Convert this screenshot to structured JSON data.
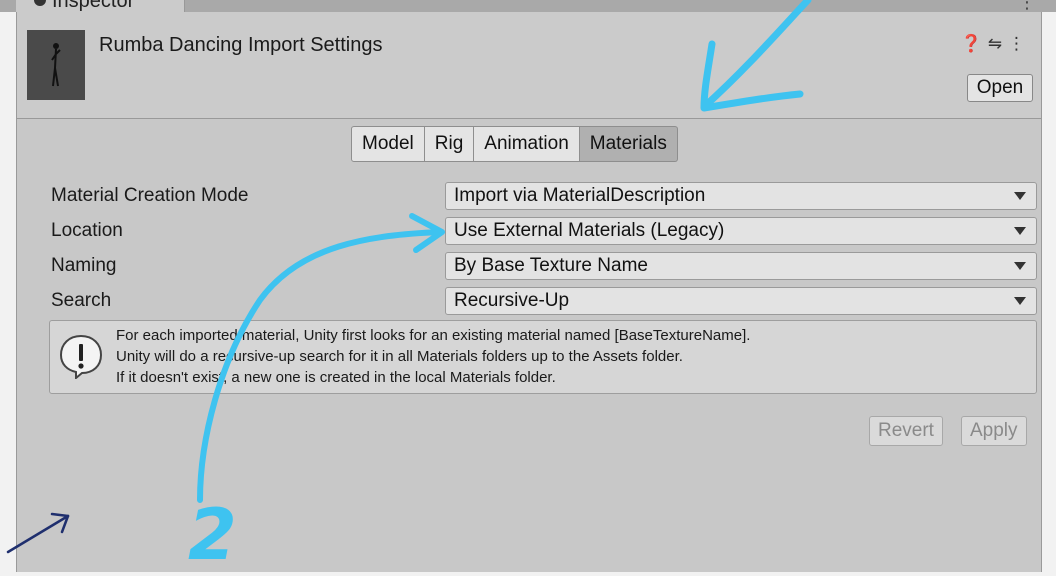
{
  "window": {
    "tab_label": "Inspector",
    "controls": "⋮"
  },
  "header": {
    "title": "Rumba Dancing Import Settings",
    "help_icon": "help-icon",
    "preset_icon": "preset-icon",
    "menu_icon": "kebab-menu-icon",
    "open_label": "Open"
  },
  "tabs": [
    {
      "label": "Model"
    },
    {
      "label": "Rig"
    },
    {
      "label": "Animation"
    },
    {
      "label": "Materials",
      "active": true
    }
  ],
  "fields": [
    {
      "label": "Material Creation Mode",
      "value": "Import via MaterialDescription"
    },
    {
      "label": "Location",
      "value": "Use External Materials (Legacy)"
    },
    {
      "label": "Naming",
      "value": "By Base Texture Name"
    },
    {
      "label": "Search",
      "value": "Recursive-Up"
    }
  ],
  "help": {
    "lines": [
      "For each imported material, Unity first looks for an existing material named [BaseTextureName].",
      "Unity will do a recursive-up search for it in all Materials folders up to the Assets folder.",
      "If it doesn't exist, a new one is created in the local Materials folder."
    ]
  },
  "buttons": {
    "revert": "Revert",
    "apply": "Apply"
  },
  "annotations": {
    "number_label": "2",
    "color": "#3ec3f0"
  }
}
